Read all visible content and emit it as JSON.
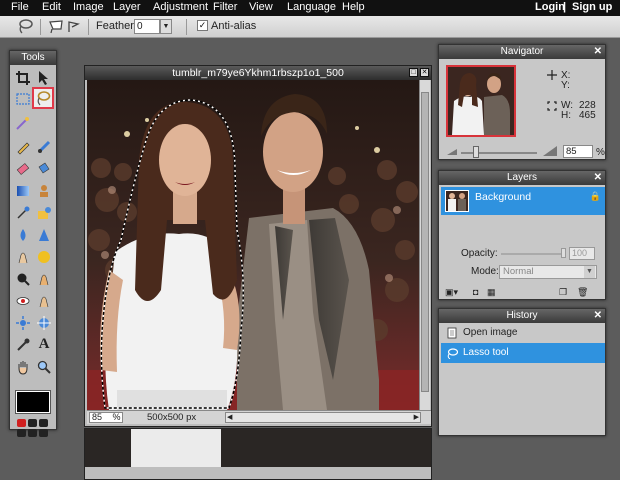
{
  "menu": {
    "items": [
      "File",
      "Edit",
      "Image",
      "Layer",
      "Adjustment",
      "Filter",
      "View",
      "Language",
      "Help"
    ],
    "login": "Login",
    "signup": "Sign up",
    "divider": "|"
  },
  "options": {
    "feather_label": "Feather:",
    "feather_value": "0",
    "antialias_label": "Anti-alias",
    "antialias_checked": true
  },
  "tools": {
    "title": "Tools",
    "selected": "lasso-tool",
    "foreground_color": "#000000"
  },
  "image_window": {
    "title": "tumblr_m79ye6Ykhm1rbszp1o1_500",
    "zoom": "85",
    "zoom_unit": "%",
    "size": "500x500 px"
  },
  "navigator": {
    "title": "Navigator",
    "x_label": "X:",
    "y_label": "Y:",
    "w_label": "W:",
    "h_label": "H:",
    "w_value": "228",
    "h_value": "465",
    "zoom": "85",
    "zoom_unit": "%"
  },
  "layers": {
    "title": "Layers",
    "items": [
      "Background"
    ],
    "opacity_label": "Opacity:",
    "opacity_value": "100",
    "mode_label": "Mode:",
    "mode_value": "Normal"
  },
  "history": {
    "title": "History",
    "items": [
      "Open image",
      "Lasso tool"
    ],
    "active_index": 1
  },
  "colors": {
    "accent": "#2f92df",
    "selection_highlight": "#e03a4a"
  }
}
